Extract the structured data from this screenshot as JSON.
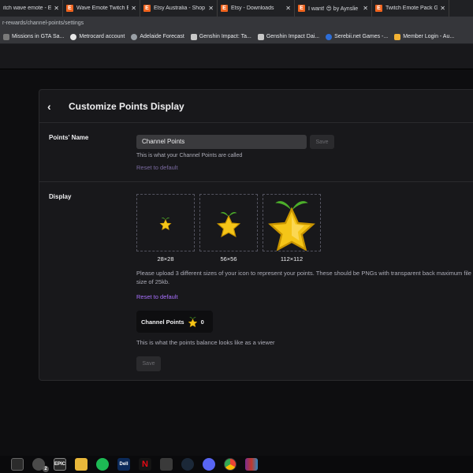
{
  "browser": {
    "tabs": [
      {
        "title": "itch wave emote - E"
      },
      {
        "title": "Wave Emote Twitch Er"
      },
      {
        "title": "Etsy Australia - Shop f"
      },
      {
        "title": "Etsy - Downloads"
      },
      {
        "title": "I want! 😍 by Aynslie"
      },
      {
        "title": "Twitch Emote Pack Ge"
      }
    ],
    "address": "r-rewards/channel-points/settings",
    "bookmarks": [
      {
        "label": "Missions in GTA Sa...",
        "color": "#7a7a7a"
      },
      {
        "label": "Metrocard account",
        "color": "#e7e7e7"
      },
      {
        "label": "Adelaide Forecast",
        "color": "#9aa0a6"
      },
      {
        "label": "Genshin Impact: Ta...",
        "color": "#c8c8c8"
      },
      {
        "label": "Genshin Impact Dai...",
        "color": "#c8c8c8"
      },
      {
        "label": "Serebii.net Games -...",
        "color": "#2d6ed8"
      },
      {
        "label": "Member Login - Au...",
        "color": "#f2b233"
      }
    ]
  },
  "page": {
    "title": "Customize Points Display",
    "back_icon": "‹",
    "points_name": {
      "label": "Points' Name",
      "value": "Channel Points",
      "save": "Save",
      "help": "This is what your Channel Points are called",
      "reset": "Reset to default"
    },
    "display": {
      "label": "Display",
      "sizes": [
        "28×28",
        "56×56",
        "112×112"
      ],
      "instructions": "Please upload 3 different sizes of your icon to represent your points. These should be PNGs with transparent back maximum file size of 25kb.",
      "reset": "Reset to default",
      "balance_label": "Channel Points",
      "balance_value": "0",
      "balance_help": "This is what the points balance looks like as a viewer",
      "save": "Save"
    }
  },
  "taskbar": {
    "icons": [
      "calendar-icon",
      "cloud-icon",
      "epic-games-icon",
      "file-explorer-icon",
      "spotify-icon",
      "dell-icon",
      "netflix-icon",
      "media-icon",
      "steam-icon",
      "discord-icon",
      "chrome-icon",
      "winrar-icon"
    ],
    "epic_label": "EPIC",
    "dell_label": "Dell",
    "netflix_label": "N",
    "badge": "2"
  },
  "colors": {
    "accent": "#a970ff",
    "star": "#f5c518",
    "leaf": "#4caf2a"
  }
}
